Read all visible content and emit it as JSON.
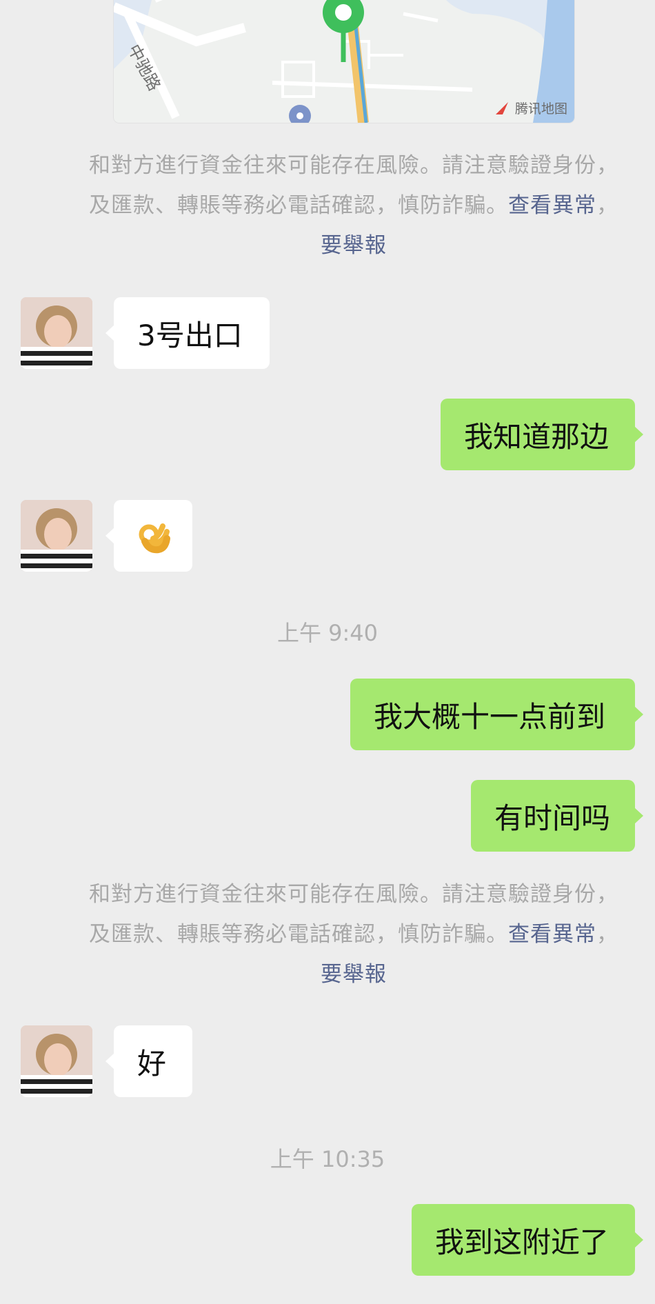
{
  "map": {
    "road_label": "中驰路",
    "brand": "腾讯地图",
    "brand_icon": "tencent-map-logo"
  },
  "notices": [
    {
      "line1": "和對方進行資金往來可能存在風險。請注意驗證身份，",
      "line2_text": "及匯款、轉賬等務必電話確認，慎防詐騙。",
      "link1": "查看異常",
      "sep": "，",
      "link2": "要舉報"
    },
    {
      "line1": "和對方進行資金往來可能存在風險。請注意驗證身份，",
      "line2_text": "及匯款、轉賬等務必電話確認，慎防詐騙。",
      "link1": "查看異常",
      "sep": "，",
      "link2": "要舉報"
    }
  ],
  "messages": [
    {
      "direction": "in",
      "text": "3号出口"
    },
    {
      "direction": "out",
      "text": "我知道那边"
    },
    {
      "direction": "in",
      "emoji": "ok-hand",
      "text": "👌"
    },
    {
      "direction": "out",
      "text": "我大概十一点前到"
    },
    {
      "direction": "out",
      "text": "有时间吗"
    },
    {
      "direction": "in",
      "text": "好"
    },
    {
      "direction": "out",
      "text": "我到这附近了"
    }
  ],
  "timestamps": [
    "上午 9:40",
    "上午 10:35"
  ],
  "colors": {
    "background": "#ededed",
    "bubble_out": "#a5e86f",
    "bubble_in": "#ffffff",
    "link": "#57658f",
    "notice_text": "#a8a8a8"
  }
}
